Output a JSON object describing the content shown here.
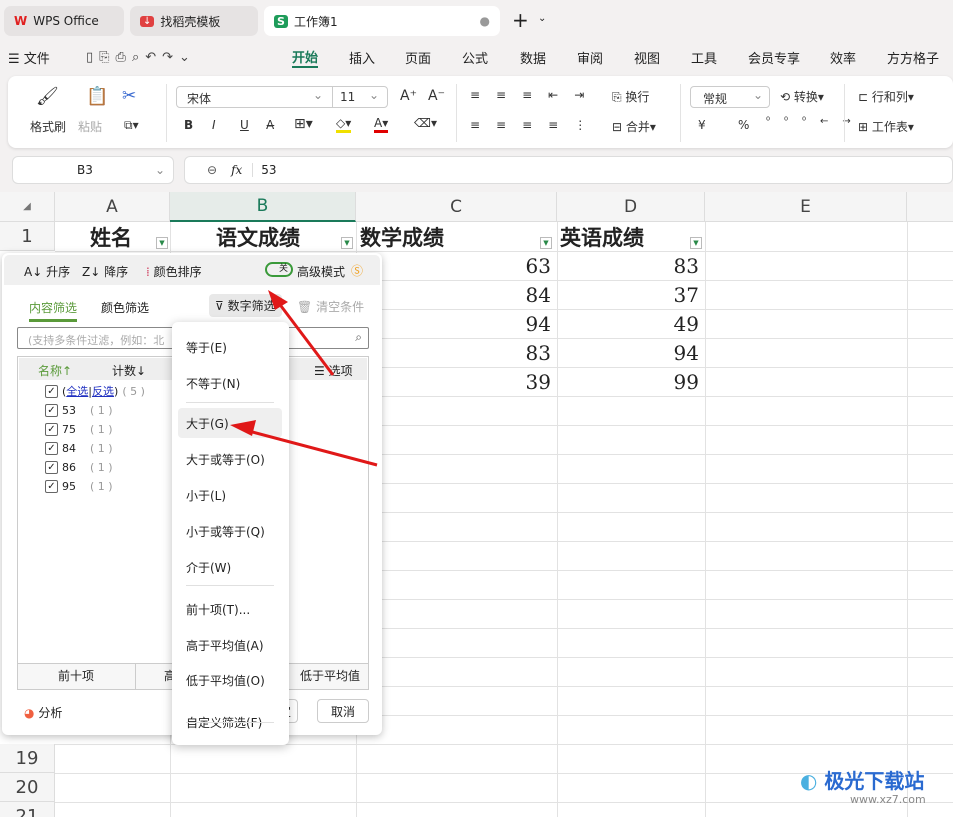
{
  "tabs": [
    {
      "label": "WPS Office"
    },
    {
      "label": "找稻壳模板"
    },
    {
      "label": "工作簿1"
    }
  ],
  "new_tab": "+",
  "menu": {
    "file": "文件",
    "items": [
      "开始",
      "插入",
      "页面",
      "公式",
      "数据",
      "审阅",
      "视图",
      "工具",
      "会员专享",
      "效率",
      "方方格子"
    ],
    "active": "开始"
  },
  "ribbon": {
    "format_painter": "格式刷",
    "paste": "粘贴",
    "font": "宋体",
    "size": "11",
    "wrap": "换行",
    "merge": "合并",
    "number_format": "常规",
    "convert": "转换",
    "row_col": "行和列",
    "worksheet": "工作表",
    "bold": "B",
    "italic": "I",
    "underline": "U",
    "currency": "¥",
    "percent": "%"
  },
  "formula_bar": {
    "cell_ref": "B3",
    "fx": "fx",
    "value": "53"
  },
  "grid": {
    "columns": [
      "A",
      "B",
      "C",
      "D",
      "E"
    ],
    "rows": [
      "1",
      "19",
      "20",
      "21"
    ],
    "headers": [
      "姓名",
      "语文成绩",
      "数学成绩",
      "英语成绩"
    ],
    "math": [
      "63",
      "84",
      "94",
      "83",
      "39"
    ],
    "english": [
      "83",
      "37",
      "49",
      "94",
      "99"
    ]
  },
  "filter_panel": {
    "sort_asc": "升序",
    "sort_desc": "降序",
    "color_sort": "颜色排序",
    "toggle": "关",
    "advanced": "高级模式",
    "tab_content": "内容筛选",
    "tab_color": "颜色筛选",
    "number_filter": "数字筛选",
    "clear": "清空条件",
    "search_placeholder": "(支持多条件过滤，例如：北",
    "col_name": "名称↑",
    "col_count": "计数↓",
    "options": "选项",
    "select_all": "全选",
    "invert": "反选",
    "total": "( 5 )",
    "items": [
      {
        "v": "53",
        "c": "( 1 )"
      },
      {
        "v": "75",
        "c": "( 1 )"
      },
      {
        "v": "84",
        "c": "( 1 )"
      },
      {
        "v": "86",
        "c": "( 1 )"
      },
      {
        "v": "95",
        "c": "( 1 )"
      }
    ],
    "top10": "前十项",
    "above": "高",
    "below": "低于平均值",
    "analyze": "分析",
    "ok": "定",
    "cancel": "取消"
  },
  "number_menu": [
    "等于(E)",
    "不等于(N)",
    "大于(G)",
    "大于或等于(O)",
    "小于(L)",
    "小于或等于(Q)",
    "介于(W)",
    "前十项(T)...",
    "高于平均值(A)",
    "低于平均值(O)",
    "自定义筛选(F)"
  ],
  "watermark": "极光下载站",
  "watermark_url": "www.xz7.com"
}
